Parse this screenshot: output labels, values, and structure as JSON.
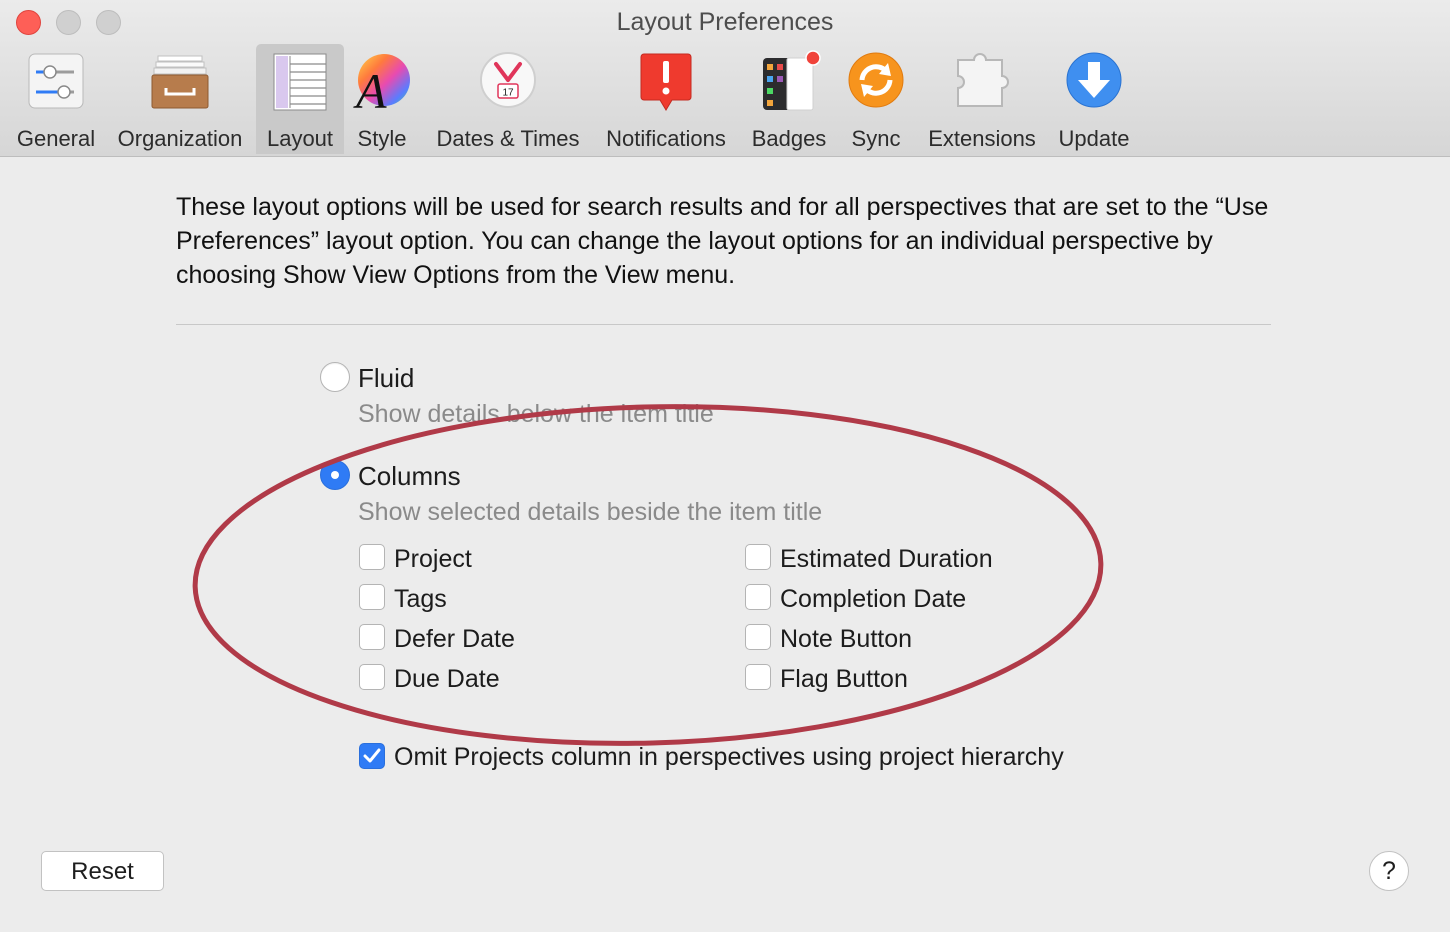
{
  "window": {
    "title": "Layout Preferences"
  },
  "toolbar": {
    "tabs": [
      {
        "label": "General",
        "icon": "sliders-icon"
      },
      {
        "label": "Organization",
        "icon": "filing-cabinet-icon"
      },
      {
        "label": "Layout",
        "icon": "layout-columns-icon",
        "selected": true
      },
      {
        "label": "Style",
        "icon": "style-letter-a-icon"
      },
      {
        "label": "Dates & Times",
        "icon": "calendar-clock-icon",
        "calendar_day": "17"
      },
      {
        "label": "Notifications",
        "icon": "exclamation-badge-icon"
      },
      {
        "label": "Badges",
        "icon": "badge-dot-icon"
      },
      {
        "label": "Sync",
        "icon": "sync-arrows-icon"
      },
      {
        "label": "Extensions",
        "icon": "puzzle-piece-icon"
      },
      {
        "label": "Update",
        "icon": "download-arrow-icon"
      }
    ]
  },
  "description": "These layout options will be used for search results and for all perspectives that are set to the “Use Preferences” layout option. You can change the layout options for an individual perspective by choosing Show View Options from the View menu.",
  "layout_options": {
    "fluid": {
      "label": "Fluid",
      "subtitle": "Show details below the item title",
      "selected": false
    },
    "columns": {
      "label": "Columns",
      "subtitle": "Show selected details beside the item title",
      "selected": true
    }
  },
  "column_checkboxes": {
    "left": [
      {
        "label": "Project",
        "checked": false
      },
      {
        "label": "Tags",
        "checked": false
      },
      {
        "label": "Defer Date",
        "checked": false
      },
      {
        "label": "Due Date",
        "checked": false
      }
    ],
    "right": [
      {
        "label": "Estimated Duration",
        "checked": false
      },
      {
        "label": "Completion Date",
        "checked": false
      },
      {
        "label": "Note Button",
        "checked": false
      },
      {
        "label": "Flag Button",
        "checked": false
      }
    ]
  },
  "omit_projects": {
    "label": "Omit Projects column in perspectives using project hierarchy",
    "checked": true
  },
  "buttons": {
    "reset": "Reset",
    "help": "?"
  },
  "colors": {
    "accent": "#2f7bf5",
    "annotation": "#b03a48",
    "close": "#fe5f57"
  }
}
